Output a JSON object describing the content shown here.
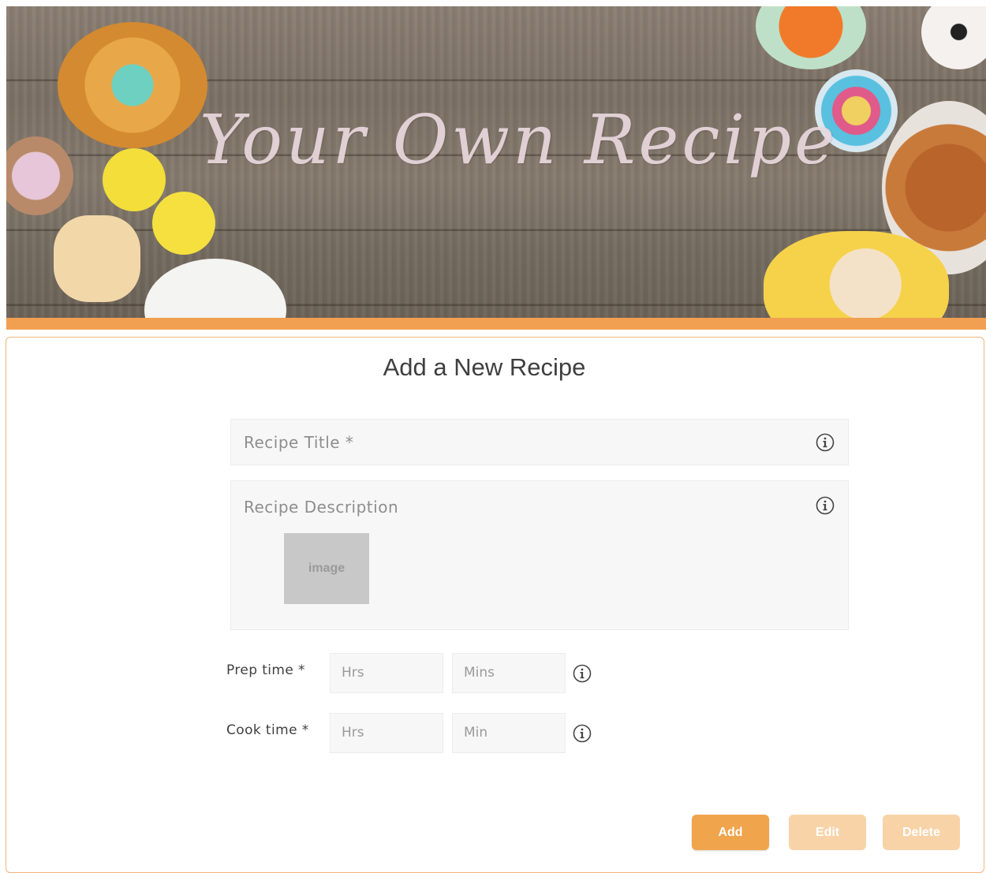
{
  "banner": {
    "title": "Your Own Recipe"
  },
  "form": {
    "heading": "Add a New Recipe",
    "title_field": {
      "placeholder": "Recipe Title *"
    },
    "description_field": {
      "placeholder": "Recipe Description",
      "image_placeholder": "image"
    },
    "prep_time": {
      "label": "Prep time *",
      "hours_placeholder": "Hrs",
      "minutes_placeholder": "Mins"
    },
    "cook_time": {
      "label": "Cook time *",
      "hours_placeholder": "Hrs",
      "minutes_placeholder": "Min"
    },
    "buttons": {
      "add": "Add",
      "edit": "Edit",
      "delete": "Delete"
    }
  },
  "colors": {
    "accent": "#f0a050",
    "button_active": "#f0a44c",
    "button_disabled": "#f8d3a8"
  },
  "icons": {
    "info": "info-icon"
  }
}
